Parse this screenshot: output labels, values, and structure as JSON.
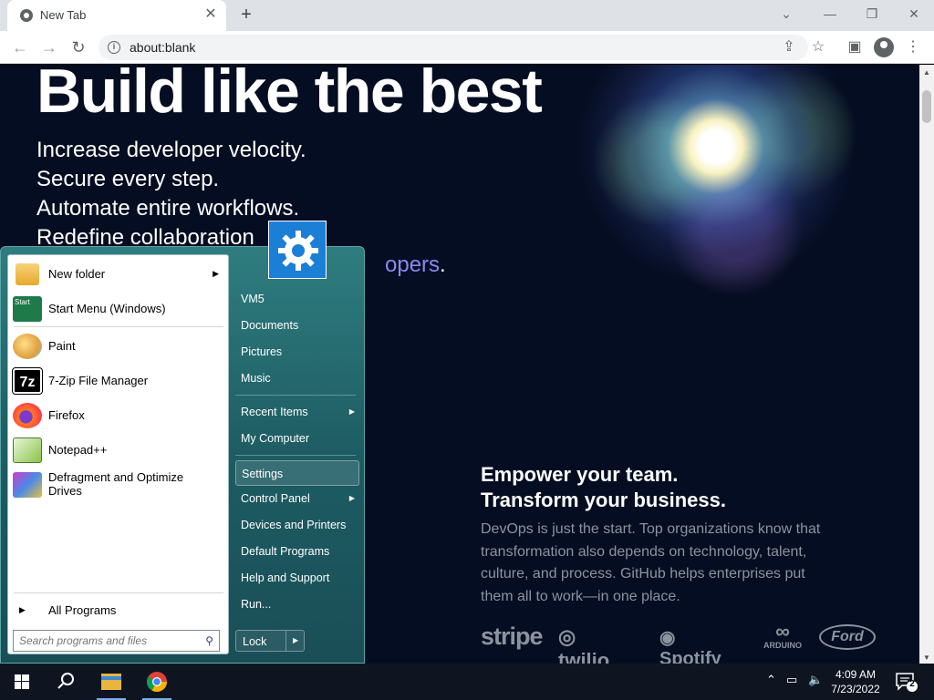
{
  "browser": {
    "tab_title": "New Tab",
    "url": "about:blank"
  },
  "page": {
    "hero_title": "Build like the best",
    "hero_lines": [
      "Increase developer velocity.",
      "Secure every step.",
      "Automate entire workflows.",
      "Redefine collaboration"
    ],
    "hero_purple_fragment": "opers",
    "hero_purple_end": ".",
    "empower_title_1": "Empower your team.",
    "empower_title_2": "Transform your business.",
    "empower_body": "DevOps is just the start. Top organizations know that transformation also depends on technology, talent, culture, and process. GitHub helps enterprises put them all to work—in one place.",
    "logos": [
      "stripe",
      "twilio",
      "Spotify",
      "ARDUINO",
      "Ford"
    ]
  },
  "start_menu": {
    "left_items": [
      {
        "label": "New folder",
        "has_submenu": true
      },
      {
        "label": "Start Menu (Windows)",
        "has_submenu": false
      },
      {
        "label": "Paint",
        "has_submenu": false
      },
      {
        "label": "7-Zip File Manager",
        "has_submenu": false
      },
      {
        "label": "Firefox",
        "has_submenu": false
      },
      {
        "label": "Notepad++",
        "has_submenu": false
      },
      {
        "label": "Defragment and Optimize Drives",
        "has_submenu": false
      }
    ],
    "all_programs": "All Programs",
    "search_placeholder": "Search programs and files",
    "right_items": [
      {
        "label": "VM5"
      },
      {
        "label": "Documents"
      },
      {
        "label": "Pictures"
      },
      {
        "label": "Music"
      },
      {
        "label": "Recent Items",
        "has_submenu": true
      },
      {
        "label": "My Computer"
      },
      {
        "label": "Settings",
        "highlighted": true
      },
      {
        "label": "Control Panel",
        "has_submenu": true
      },
      {
        "label": "Devices and Printers"
      },
      {
        "label": "Default Programs"
      },
      {
        "label": "Help and Support"
      },
      {
        "label": "Run..."
      }
    ],
    "lock_label": "Lock",
    "start_icon_label": "Start"
  },
  "taskbar": {
    "time": "4:09 AM",
    "date": "7/23/2022",
    "notification_count": "2"
  },
  "colors": {
    "page_bg": "#040d21",
    "start_menu_accent": "#2f7d80",
    "user_tile": "#1c7fd6",
    "purple_text": "#8b87f0"
  }
}
